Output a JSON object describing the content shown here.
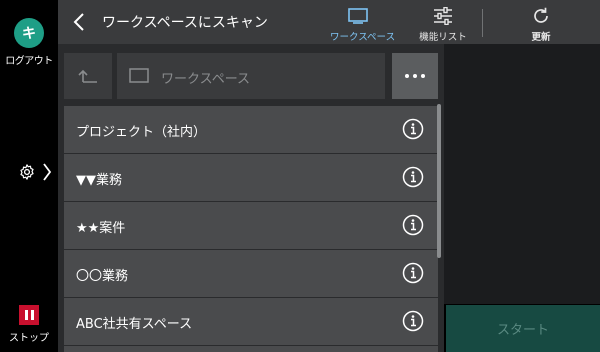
{
  "sidebar": {
    "logout_icon_char": "キ",
    "logout_label": "ログアウト",
    "stop_label": "ストップ",
    "stop_color": "#c8102e",
    "logout_color": "#1e9e86"
  },
  "header": {
    "title": "ワークスペースにスキャン",
    "tabs": [
      {
        "label": "ワークスペース",
        "icon": "monitor-icon",
        "active": true
      },
      {
        "label": "機能リスト",
        "icon": "sliders-icon",
        "active": false
      },
      {
        "label": "更新",
        "icon": "refresh-icon",
        "active": false
      }
    ]
  },
  "toolbar": {
    "path_placeholder": "ワークスペース"
  },
  "list": {
    "items": [
      {
        "label": "プロジェクト（社内）"
      },
      {
        "label": "▼▼業務"
      },
      {
        "label": "★★案件"
      },
      {
        "label": "〇〇業務"
      },
      {
        "label": "ABC社共有スペース"
      }
    ]
  },
  "start_label": "スタート",
  "colors": {
    "active_tab": "#7ec4f4",
    "start_bg": "#174a42"
  }
}
